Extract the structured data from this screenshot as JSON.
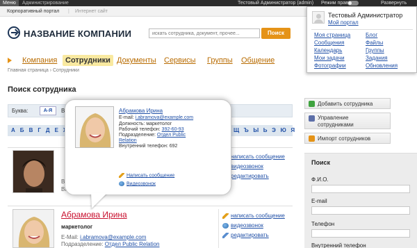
{
  "adminbar": {
    "menu": "Меню",
    "admin": "Администрирование",
    "user": "Тестовый Администратор (admin)",
    "edit_mode": "Режим правки",
    "expand": "Развернуть"
  },
  "sitesbar": {
    "portal": "Корпоративный портал",
    "internet": "Интернет сайт"
  },
  "header": {
    "company": "НАЗВАНИЕ КОМПАНИИ",
    "search_placeholder": "искать сотрудника, документ, прочее...",
    "search_button": "Поиск"
  },
  "nav": {
    "items": [
      "Компания",
      "Сотрудники",
      "Документы",
      "Сервисы",
      "Группы",
      "Общение"
    ],
    "active": "Сотрудники"
  },
  "breadcrumb": "Главная страница  ›  Сотрудники",
  "page_title": "Поиск сотрудника",
  "filter": {
    "letter_label": "Буква:",
    "az": "А-Я",
    "view_label": "Вид:",
    "alphabet": "А Б В Г Д Е Ж З И",
    "alphabet_end": "Щ Ъ Ы Ь Э Ю Я"
  },
  "card_actions": {
    "write": "написать сообщение",
    "video": "видеозвонок",
    "edit": "редактировать"
  },
  "first_card": {
    "ghost_post": "Вну",
    "ghost_phone": "Внутренний"
  },
  "person": {
    "name": "Абрамова Ирина",
    "post": "маркетолог",
    "email_label": "E-Mail:",
    "email": "i.abramova@example.com",
    "dept_label": "Подразделение:",
    "dept": "Отдел Public Relation"
  },
  "tooltip": {
    "name": "Абрамова Ирина",
    "email_label": "E-mail:",
    "email": "i.abramova@example.com",
    "post_line": "Должность: маркетолог",
    "phone_label": "Рабочий телефон:",
    "phone": "392-60-93",
    "dept_label": "Подразделение:",
    "dept_1": "Отдел Public",
    "dept_2": "Relation",
    "inner_phone": "Внутренний телефон: 692",
    "write": "Написать сообщение",
    "video": "Видеозвонок"
  },
  "dropdown": {
    "user": "Тестовый Администратор",
    "portal": "Мой портал",
    "left": [
      "Моя страница",
      "Сообщения",
      "Календарь",
      "Мои задачи",
      "Фотографии"
    ],
    "right": [
      "Блог",
      "Файлы",
      "Группы",
      "Задания",
      "Обновления"
    ]
  },
  "sidebar": {
    "add": "Добавить сотрудника",
    "manage_1": "Управление",
    "manage_2": "сотрудниками",
    "import": "Импорт сотрудников",
    "search_title": "Поиск",
    "fio": "Ф.И.О.",
    "email": "E-mail",
    "phone": "Телефон",
    "inner_phone": "Внутренний телефон"
  },
  "colors": {
    "accent": "#e59317",
    "link": "#1f4fa6",
    "name_red": "#c8102e",
    "active_tab_bg": "#f9e9a0"
  }
}
